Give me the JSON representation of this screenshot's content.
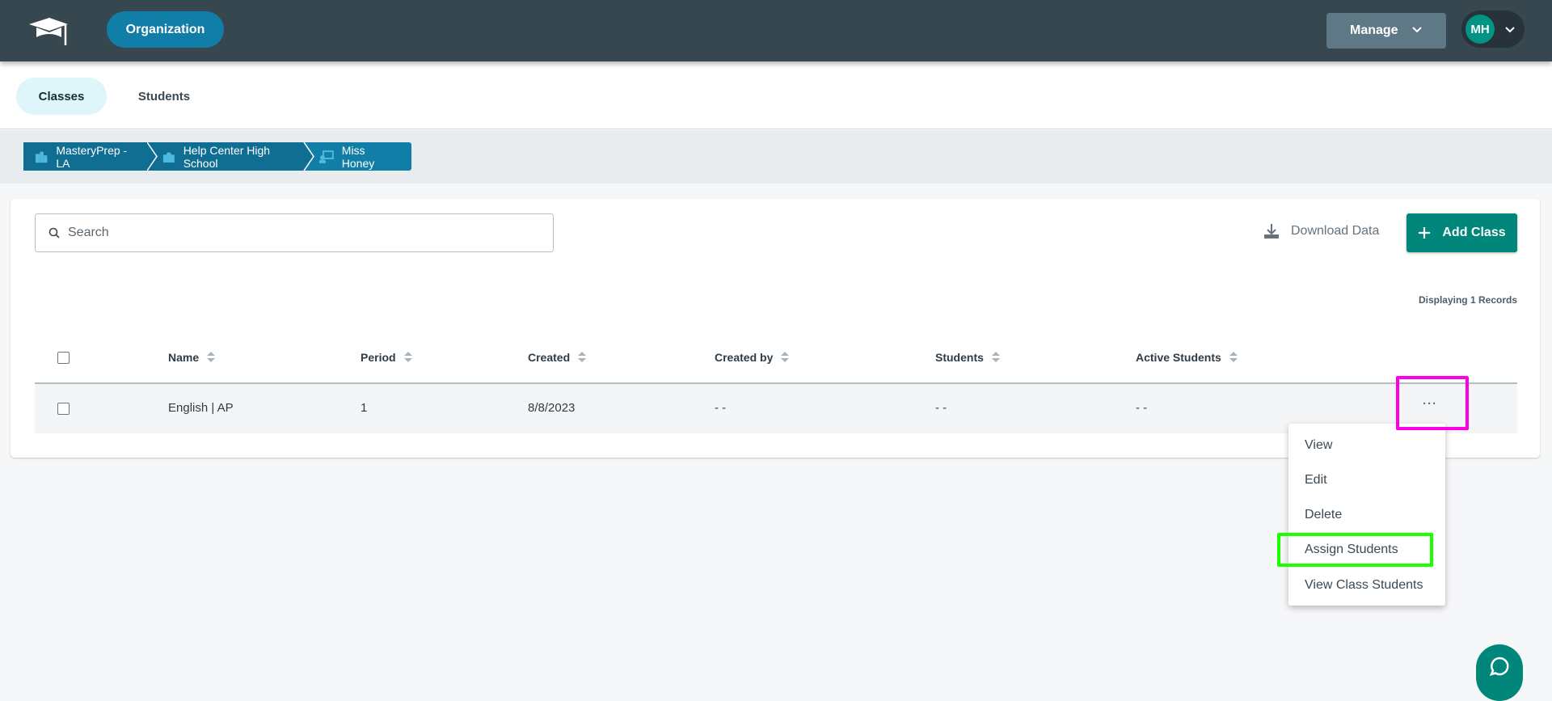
{
  "header": {
    "logo_icon": "graduation-cap-icon",
    "organization_label": "Organization",
    "manage_label": "Manage",
    "user_initials": "MH"
  },
  "tabs": [
    {
      "label": "Classes",
      "active": true
    },
    {
      "label": "Students",
      "active": false
    }
  ],
  "breadcrumb": [
    {
      "label": "MasteryPrep - LA",
      "icon": "buildings-icon"
    },
    {
      "label": "Help Center High School",
      "icon": "school-icon"
    },
    {
      "label": "Miss Honey",
      "icon": "teacher-icon"
    }
  ],
  "toolbar": {
    "search_placeholder": "Search",
    "download_label": "Download Data",
    "add_class_label": "Add Class"
  },
  "records_text": "Displaying 1 Records",
  "table": {
    "columns": [
      "Name",
      "Period",
      "Created",
      "Created by",
      "Students",
      "Active Students"
    ],
    "rows": [
      {
        "name": "English | AP",
        "period": "1",
        "created": "8/8/2023",
        "created_by": "- -",
        "students": "- -",
        "active_students": "- -",
        "actions": "···"
      }
    ]
  },
  "row_menu": {
    "items": [
      "View",
      "Edit",
      "Delete",
      "Assign Students",
      "View Class Students"
    ]
  },
  "colors": {
    "header": "#37474f",
    "primary_blue": "#117ea8",
    "teal": "#00867a",
    "highlight_magenta": "#ff00e6",
    "highlight_green": "#1fff00"
  }
}
